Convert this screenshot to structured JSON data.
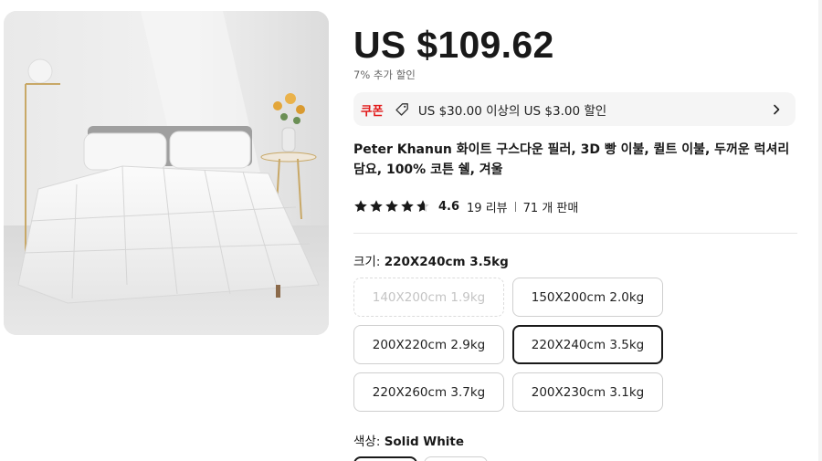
{
  "product": {
    "price": "US $109.62",
    "extra_discount": "7% 추가 할인",
    "coupon": {
      "label": "쿠폰",
      "text": "US $30.00 이상의 US $3.00 할인",
      "icon": "tag-icon"
    },
    "title": "Peter Khanun 화이트 구스다운 필러, 3D 빵 이불, 퀼트 이불, 두꺼운 럭셔리 담요, 100% 코튼 쉘, 겨울",
    "rating": {
      "value": "4.6",
      "stars": 4.6,
      "reviews": "19 리뷰",
      "sold": "71 개 판매"
    }
  },
  "size": {
    "label": "크기:",
    "selected": "220X240cm 3.5kg",
    "options": [
      {
        "text": "140X200cm 1.9kg",
        "state": "disabled"
      },
      {
        "text": "150X200cm 2.0kg",
        "state": "normal"
      },
      {
        "text": "200X220cm 2.9kg",
        "state": "normal"
      },
      {
        "text": "220X240cm 3.5kg",
        "state": "selected"
      },
      {
        "text": "220X260cm 3.7kg",
        "state": "normal"
      },
      {
        "text": "200X230cm 3.1kg",
        "state": "normal"
      }
    ]
  },
  "color": {
    "label": "색상:",
    "selected": "Solid White"
  },
  "colors": {
    "coupon_red": "#e21a1a",
    "text": "#191919",
    "border": "#cfcfcf"
  }
}
